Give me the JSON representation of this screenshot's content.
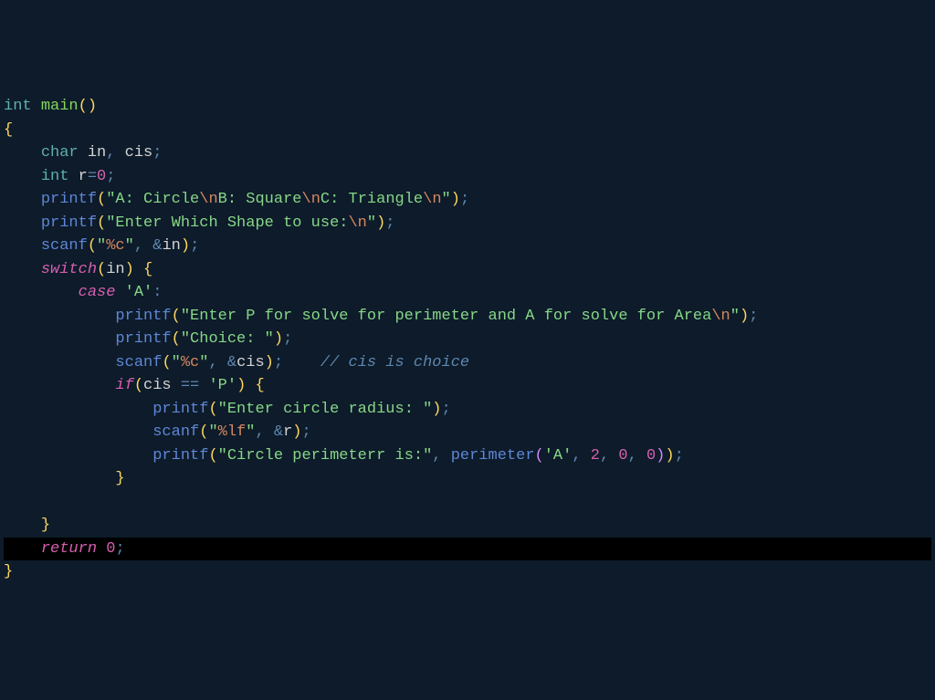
{
  "code": {
    "lines": [
      {
        "indent": 0,
        "segments": [
          {
            "t": "kw-type",
            "v": "int"
          },
          {
            "t": "sp",
            "v": " "
          },
          {
            "t": "fn-main",
            "v": "main"
          },
          {
            "t": "paren",
            "v": "()"
          }
        ]
      },
      {
        "indent": 0,
        "segments": [
          {
            "t": "brace",
            "v": "{"
          }
        ]
      },
      {
        "indent": 1,
        "segments": [
          {
            "t": "kw-type",
            "v": "char"
          },
          {
            "t": "sp",
            "v": " "
          },
          {
            "t": "ident",
            "v": "in"
          },
          {
            "t": "punct",
            "v": ", "
          },
          {
            "t": "ident",
            "v": "cis"
          },
          {
            "t": "punct",
            "v": ";"
          }
        ]
      },
      {
        "indent": 1,
        "segments": [
          {
            "t": "kw-type",
            "v": "int"
          },
          {
            "t": "sp",
            "v": " "
          },
          {
            "t": "ident",
            "v": "r"
          },
          {
            "t": "op",
            "v": "="
          },
          {
            "t": "number",
            "v": "0"
          },
          {
            "t": "punct",
            "v": ";"
          }
        ]
      },
      {
        "indent": 1,
        "segments": [
          {
            "t": "fn-call",
            "v": "printf"
          },
          {
            "t": "paren",
            "v": "("
          },
          {
            "t": "string",
            "v": "\"A: Circle"
          },
          {
            "t": "escape",
            "v": "\\n"
          },
          {
            "t": "string",
            "v": "B: Square"
          },
          {
            "t": "escape",
            "v": "\\n"
          },
          {
            "t": "string",
            "v": "C: Triangle"
          },
          {
            "t": "escape",
            "v": "\\n"
          },
          {
            "t": "string",
            "v": "\""
          },
          {
            "t": "paren",
            "v": ")"
          },
          {
            "t": "punct",
            "v": ";"
          }
        ]
      },
      {
        "indent": 1,
        "segments": [
          {
            "t": "fn-call",
            "v": "printf"
          },
          {
            "t": "paren",
            "v": "("
          },
          {
            "t": "string",
            "v": "\"Enter Which Shape to use:"
          },
          {
            "t": "escape",
            "v": "\\n"
          },
          {
            "t": "string",
            "v": "\""
          },
          {
            "t": "paren",
            "v": ")"
          },
          {
            "t": "punct",
            "v": ";"
          }
        ]
      },
      {
        "indent": 1,
        "segments": [
          {
            "t": "fn-call",
            "v": "scanf"
          },
          {
            "t": "paren",
            "v": "("
          },
          {
            "t": "string",
            "v": "\""
          },
          {
            "t": "escape",
            "v": "%c"
          },
          {
            "t": "string",
            "v": "\""
          },
          {
            "t": "punct",
            "v": ", "
          },
          {
            "t": "op",
            "v": "&"
          },
          {
            "t": "ident",
            "v": "in"
          },
          {
            "t": "paren",
            "v": ")"
          },
          {
            "t": "punct",
            "v": ";"
          }
        ]
      },
      {
        "indent": 1,
        "segments": [
          {
            "t": "kw-control",
            "v": "switch"
          },
          {
            "t": "paren",
            "v": "("
          },
          {
            "t": "ident",
            "v": "in"
          },
          {
            "t": "paren",
            "v": ")"
          },
          {
            "t": "sp",
            "v": " "
          },
          {
            "t": "brace",
            "v": "{"
          }
        ]
      },
      {
        "indent": 2,
        "segments": [
          {
            "t": "kw-case",
            "v": "case"
          },
          {
            "t": "sp",
            "v": " "
          },
          {
            "t": "charlit",
            "v": "'A'"
          },
          {
            "t": "punct",
            "v": ":"
          }
        ]
      },
      {
        "indent": 3,
        "segments": [
          {
            "t": "fn-call",
            "v": "printf"
          },
          {
            "t": "paren",
            "v": "("
          },
          {
            "t": "string",
            "v": "\"Enter P for solve for perimeter and A for solve for Area"
          },
          {
            "t": "escape",
            "v": "\\n"
          },
          {
            "t": "string",
            "v": "\""
          },
          {
            "t": "paren",
            "v": ")"
          },
          {
            "t": "punct",
            "v": ";"
          }
        ]
      },
      {
        "indent": 3,
        "segments": [
          {
            "t": "fn-call",
            "v": "printf"
          },
          {
            "t": "paren",
            "v": "("
          },
          {
            "t": "string",
            "v": "\"Choice: \""
          },
          {
            "t": "paren",
            "v": ")"
          },
          {
            "t": "punct",
            "v": ";"
          }
        ]
      },
      {
        "indent": 3,
        "segments": [
          {
            "t": "fn-call",
            "v": "scanf"
          },
          {
            "t": "paren",
            "v": "("
          },
          {
            "t": "string",
            "v": "\""
          },
          {
            "t": "escape",
            "v": "%c"
          },
          {
            "t": "string",
            "v": "\""
          },
          {
            "t": "punct",
            "v": ", "
          },
          {
            "t": "op",
            "v": "&"
          },
          {
            "t": "ident",
            "v": "cis"
          },
          {
            "t": "paren",
            "v": ")"
          },
          {
            "t": "punct",
            "v": ";"
          },
          {
            "t": "sp",
            "v": "    "
          },
          {
            "t": "comment",
            "v": "// cis is choice"
          }
        ]
      },
      {
        "indent": 3,
        "segments": [
          {
            "t": "kw-control",
            "v": "if"
          },
          {
            "t": "paren",
            "v": "("
          },
          {
            "t": "ident",
            "v": "cis"
          },
          {
            "t": "sp",
            "v": " "
          },
          {
            "t": "op",
            "v": "=="
          },
          {
            "t": "sp",
            "v": " "
          },
          {
            "t": "charlit",
            "v": "'P'"
          },
          {
            "t": "paren",
            "v": ")"
          },
          {
            "t": "sp",
            "v": " "
          },
          {
            "t": "brace",
            "v": "{"
          }
        ]
      },
      {
        "indent": 4,
        "segments": [
          {
            "t": "fn-call",
            "v": "printf"
          },
          {
            "t": "paren",
            "v": "("
          },
          {
            "t": "string",
            "v": "\"Enter circle radius: \""
          },
          {
            "t": "paren",
            "v": ")"
          },
          {
            "t": "punct",
            "v": ";"
          }
        ]
      },
      {
        "indent": 4,
        "segments": [
          {
            "t": "fn-call",
            "v": "scanf"
          },
          {
            "t": "paren",
            "v": "("
          },
          {
            "t": "string",
            "v": "\""
          },
          {
            "t": "escape",
            "v": "%lf"
          },
          {
            "t": "string",
            "v": "\""
          },
          {
            "t": "punct",
            "v": ", "
          },
          {
            "t": "op",
            "v": "&"
          },
          {
            "t": "ident",
            "v": "r"
          },
          {
            "t": "paren",
            "v": ")"
          },
          {
            "t": "punct",
            "v": ";"
          }
        ]
      },
      {
        "indent": 4,
        "segments": [
          {
            "t": "fn-call",
            "v": "printf"
          },
          {
            "t": "paren",
            "v": "("
          },
          {
            "t": "string",
            "v": "\"Circle perimeterr is:\""
          },
          {
            "t": "punct",
            "v": ", "
          },
          {
            "t": "fn-call",
            "v": "perimeter"
          },
          {
            "t": "bracket",
            "v": "("
          },
          {
            "t": "charlit",
            "v": "'A'"
          },
          {
            "t": "punct",
            "v": ", "
          },
          {
            "t": "number",
            "v": "2"
          },
          {
            "t": "punct",
            "v": ", "
          },
          {
            "t": "number",
            "v": "0"
          },
          {
            "t": "punct",
            "v": ", "
          },
          {
            "t": "number",
            "v": "0"
          },
          {
            "t": "bracket",
            "v": ")"
          },
          {
            "t": "paren",
            "v": ")"
          },
          {
            "t": "punct",
            "v": ";"
          }
        ]
      },
      {
        "indent": 3,
        "segments": [
          {
            "t": "brace",
            "v": "}"
          }
        ]
      },
      {
        "indent": 0,
        "blank": true,
        "segments": []
      },
      {
        "indent": 1,
        "segments": [
          {
            "t": "brace",
            "v": "}"
          }
        ]
      },
      {
        "indent": 1,
        "highlight": true,
        "segments": [
          {
            "t": "kw-control",
            "v": "return"
          },
          {
            "t": "sp",
            "v": " "
          },
          {
            "t": "number",
            "v": "0"
          },
          {
            "t": "punct",
            "v": ";"
          }
        ]
      },
      {
        "indent": 0,
        "segments": [
          {
            "t": "brace",
            "v": "}"
          }
        ]
      }
    ]
  }
}
